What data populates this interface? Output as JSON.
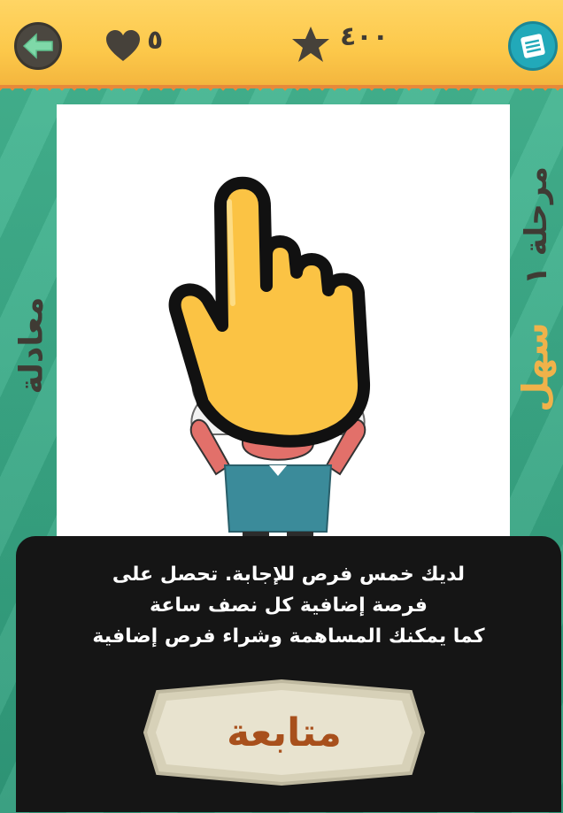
{
  "header": {
    "lives": "٥",
    "score": "٤٠٠"
  },
  "sidebar": {
    "left_label": "معادلة",
    "level_label": "مرحلة ١",
    "difficulty_label": "سهل"
  },
  "dialog": {
    "lines": [
      "لديك خمس فرص للإجابة. تحصل على",
      "فرصة إضافية كل نصف ساعة",
      "كما يمكنك المساهمة وشراء فرص إضافية"
    ],
    "continue_label": "متابعة"
  },
  "icons": {
    "back": "back-arrow-icon",
    "lives": "heart-icon",
    "score": "star-icon",
    "menu": "menu-icon",
    "tutorial": "pointing-hand-icon"
  },
  "colors": {
    "topbar": "#fcc84a",
    "background": "#3fae8c",
    "menu_button": "#22a9b9",
    "difficulty_text": "#f0b24a",
    "continue_text": "#a8501c"
  }
}
